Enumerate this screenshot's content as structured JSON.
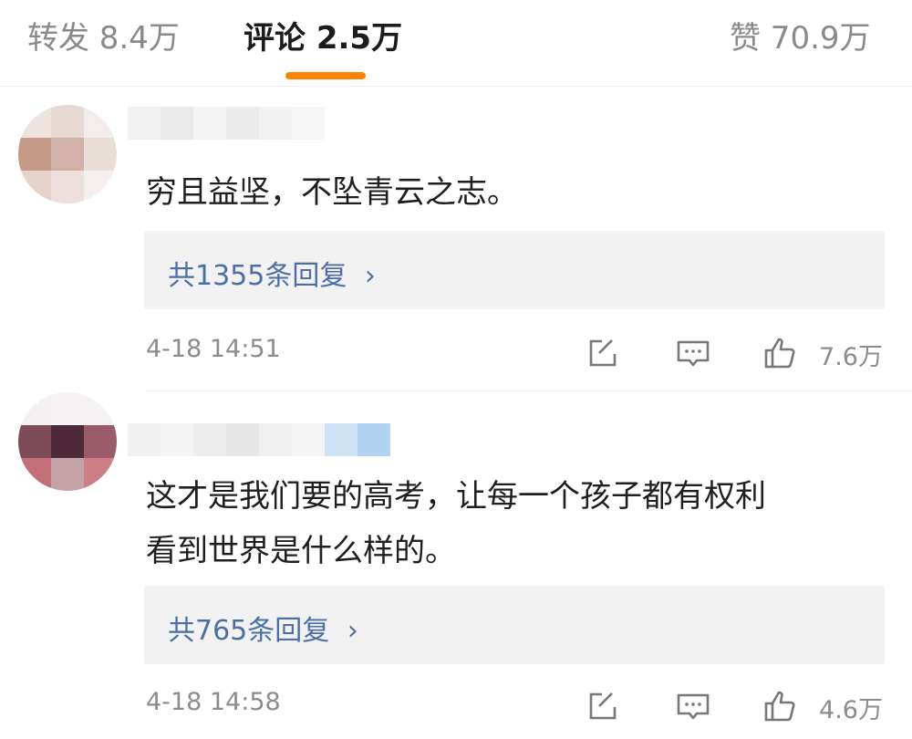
{
  "tabs": {
    "reposts": "转发 8.4万",
    "comments": "评论 2.5万",
    "likes": "赞 70.9万"
  },
  "colors": {
    "accent": "#ff8200",
    "link": "#4a6fa6",
    "muted": "#8c8c8c"
  },
  "comments": [
    {
      "text": "穷且益坚，不坠青云之志。",
      "replies": "共1355条回复",
      "replies_arrow": "›",
      "time": "4-18 14:51",
      "likes": "7.6万",
      "icons": [
        "share-icon",
        "comment-icon",
        "like-icon"
      ]
    },
    {
      "text_line1": "这才是我们要的高考，让每一个孩子都有权利",
      "text_line2": "看到世界是什么样的。",
      "replies": "共765条回复",
      "replies_arrow": "›",
      "time": "4-18 14:58",
      "likes": "4.6万",
      "icons": [
        "share-icon",
        "comment-icon",
        "like-icon"
      ]
    }
  ]
}
